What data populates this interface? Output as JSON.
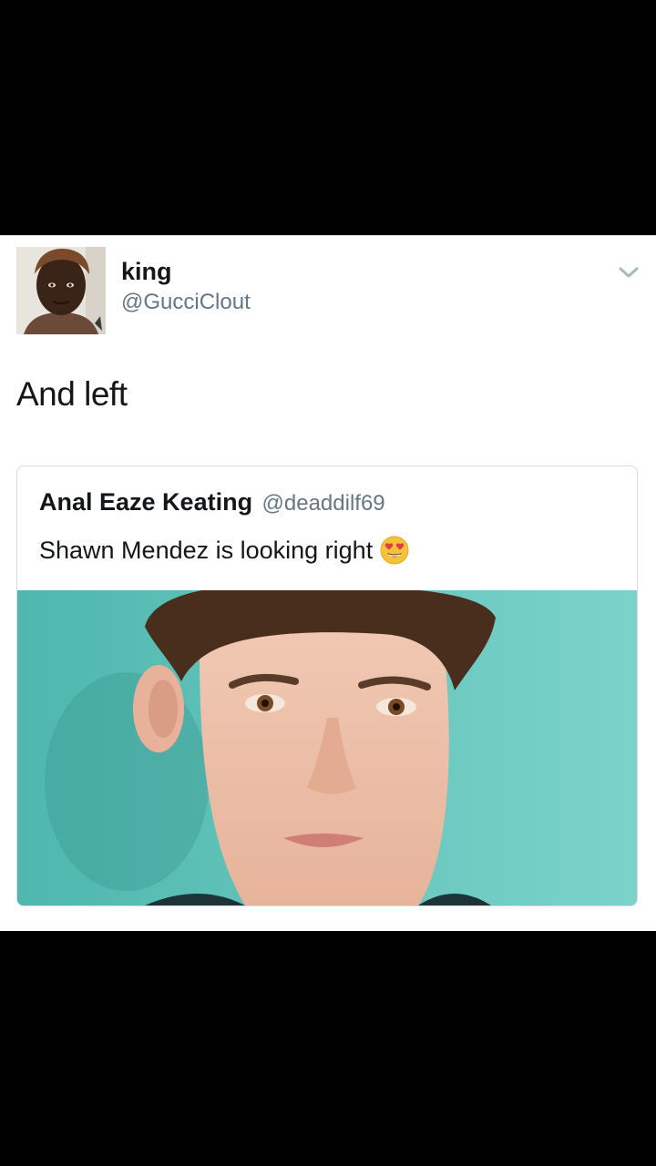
{
  "tweet": {
    "display_name": "king",
    "handle": "@GucciClout",
    "text": "And left",
    "avatar_icon": "user-avatar-photo",
    "menu_icon": "chevron-down-icon"
  },
  "quoted_tweet": {
    "display_name": "Anal Eaze Keating",
    "handle": "@deaddilf69",
    "text": "Shawn Mendez is looking right",
    "emoji_icon": "heart-eyes-emoji-icon",
    "media_icon": "portrait-photo"
  },
  "colors": {
    "background": "#000000",
    "card": "#ffffff",
    "primary_text": "#14171a",
    "secondary_text": "#657786",
    "photo_background": "#6ec9c1"
  }
}
